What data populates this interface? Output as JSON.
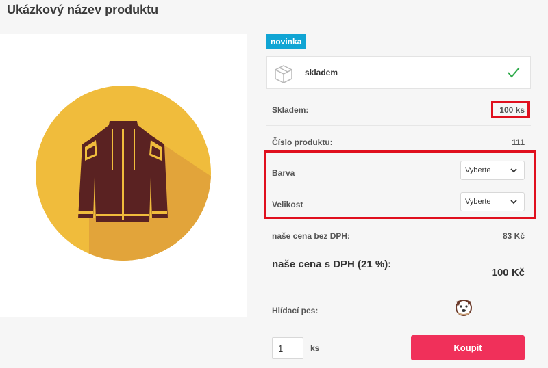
{
  "product": {
    "title": "Ukázkový název produktu",
    "badge": "novinka",
    "availability": "skladem"
  },
  "details": {
    "stock_label": "Skladem:",
    "stock_value": "100 ks",
    "code_label": "Číslo produktu:",
    "code_value": "111",
    "color_label": "Barva",
    "color_select": "Vyberte",
    "size_label": "Velikost",
    "size_select": "Vyberte",
    "price_no_vat_label": "naše cena bez DPH:",
    "price_no_vat_value": "83 Kč",
    "price_vat_label": "naše cena s DPH (21 %):",
    "price_vat_value": "100 Kč",
    "watchdog_label": "Hlídací pes:"
  },
  "cart": {
    "quantity": "1",
    "unit": "ks",
    "buy_label": "Koupit"
  },
  "colors": {
    "accent": "#f0305a",
    "badge": "#11a5d4",
    "highlight": "#e0101e",
    "check": "#2eaa4a"
  }
}
